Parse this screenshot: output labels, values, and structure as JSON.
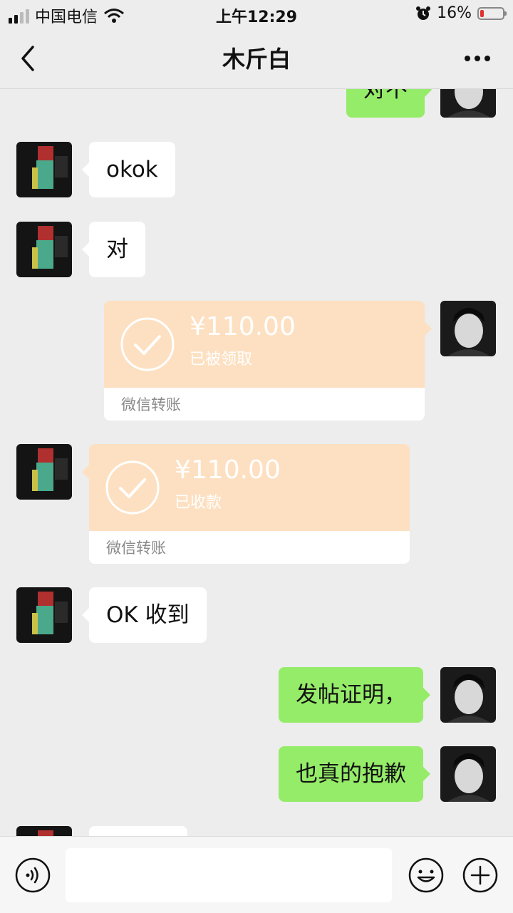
{
  "status_bar": {
    "carrier": "中国电信",
    "time": "上午12:29",
    "battery_percent": "16%",
    "battery_level": 0.16
  },
  "nav": {
    "title": "木斤白",
    "back_icon": "chevron-left-icon",
    "more_icon": "more-dots-icon"
  },
  "messages": [
    {
      "side": "right",
      "type": "text",
      "text": "对不"
    },
    {
      "side": "left",
      "type": "text",
      "text": "okok"
    },
    {
      "side": "left",
      "type": "text",
      "text": "对"
    },
    {
      "side": "right",
      "type": "transfer",
      "amount": "¥110.00",
      "status": "已被领取",
      "label": "微信转账"
    },
    {
      "side": "left",
      "type": "transfer",
      "amount": "¥110.00",
      "status": "已收款",
      "label": "微信转账"
    },
    {
      "side": "left",
      "type": "text",
      "text": "OK 收到"
    },
    {
      "side": "right",
      "type": "text",
      "text": "发帖证明，"
    },
    {
      "side": "right",
      "type": "text",
      "text": "也真的抱歉"
    },
    {
      "side": "left",
      "type": "text",
      "text": ""
    }
  ],
  "input_bar": {
    "voice_icon": "voice-icon",
    "emoji_icon": "emoji-icon",
    "plus_icon": "plus-icon",
    "input_value": ""
  },
  "colors": {
    "background": "#ededed",
    "sent_bubble": "#95ec69",
    "received_bubble": "#ffffff",
    "transfer_bg": "#fde0c1",
    "battery_low": "#e0322e"
  }
}
